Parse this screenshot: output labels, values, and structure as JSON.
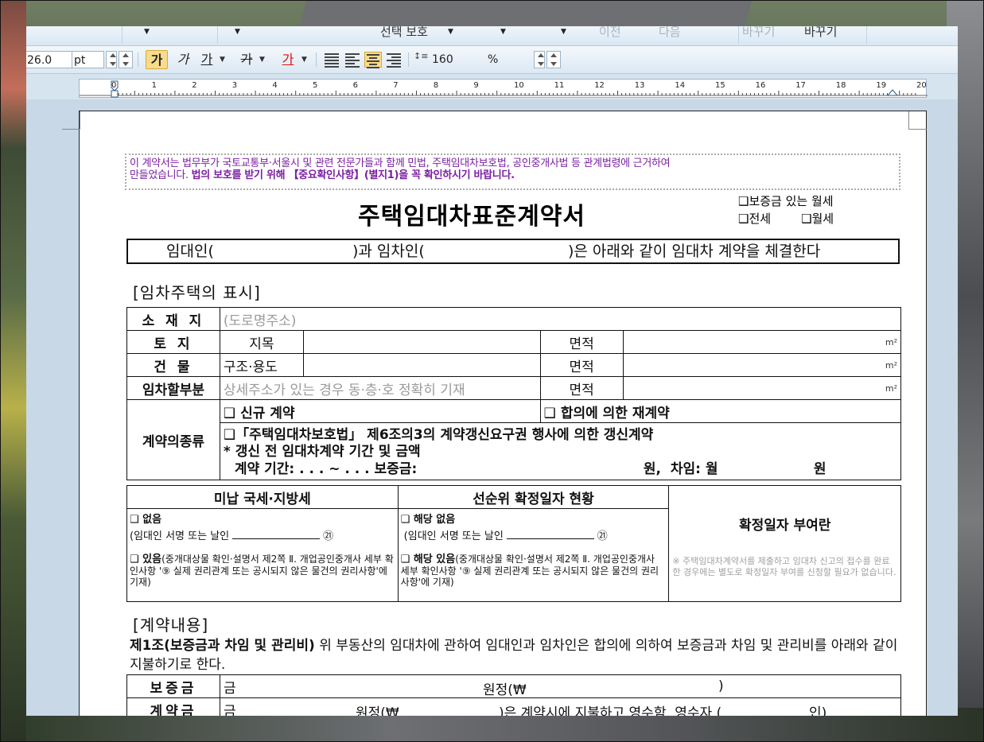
{
  "toolbar_top": {
    "selection_protect": "선택 보호",
    "replace_left": "바꾸기",
    "replace_right": "바꾸기",
    "faint_a": "이전",
    "faint_b": "다음"
  },
  "format_bar": {
    "font_size": "26.0",
    "font_unit": "pt",
    "bold": "가",
    "italic": "가",
    "underline": "가",
    "strike": "가",
    "color": "가",
    "line_spacing": "160",
    "line_spacing_unit": "%"
  },
  "ruler": {
    "ticks": [
      "0",
      "1",
      "2",
      "3",
      "4",
      "5",
      "6",
      "7",
      "8",
      "9",
      "10",
      "11",
      "12",
      "13",
      "14",
      "15",
      "16",
      "17",
      "18",
      "19",
      "20"
    ]
  },
  "document": {
    "notice_line1": "이 계약서는 법무부가 국토교통부·서울시 및 관련 전문가들과 함께 민법, 주택임대차보호법, 공인중개사법 등 관계법령에 근거하여",
    "notice_line2_a": "만들었습니다.",
    "notice_line2_b": "법의 보호를 받기 위해 【중요확인사항】(별지1)을 꼭 확인하시기 바랍니다.",
    "title": "주택임대차표준계약서",
    "type_options": [
      "❑보증금 있는 월세",
      "❑전세",
      "❑월세"
    ],
    "intro_a": "임대인(",
    "intro_b": ")과 임차인(",
    "intro_c": ")은 아래와 같이 임대차 계약을 체결한다",
    "section1": "[임차주택의 표시]",
    "property": {
      "location_label": "소 재 지",
      "location_ph": "(도로명주소)",
      "land_label": "토 지",
      "land_sub": "지목",
      "building_label": "건 물",
      "building_sub": "구조·용도",
      "area_label": "면적",
      "unit": "m²",
      "leased_label": "임차할부분",
      "leased_ph": "상세주소가 있는 경우 동·층·호 정확히 기재",
      "contract_type_label": "계약의종류",
      "new_contract": "❑ 신규 계약",
      "recontract": "❑ 합의에 의한 재계약",
      "renewal": "❑「주택임대차보호법」 제6조의3의 계약갱신요구권 행사에 의한 갱신계약",
      "renewal_note": "* 갱신 전 임대차계약 기간 및 금액",
      "renewal_period": "계약 기간:     .     .     . ~     .     .     .   보증금:",
      "renewal_won": "원,",
      "renewal_rent": "차임: 월",
      "renewal_won2": "원"
    },
    "tax": {
      "header": "미납 국세·지방세",
      "none": "❑ 없음",
      "sign_line": "(임대인 서명 또는 날인",
      "seal": "㉑",
      "exists": "❑ 있음",
      "exists_note": "(중개대상물 확인·설명서 제2쪽 Ⅱ. 개업공인중개사 세부 확인사항 '⑨ 실제 권리관계 또는 공시되지 않은 물건의 권리사항'에 기재)"
    },
    "priority": {
      "header": "선순위 확정일자 현황",
      "none": "❑ 해당 없음",
      "sign_line": "(임대인 서명 또는 날인",
      "seal": "㉑",
      "exists": "❑ 해당 있음",
      "exists_note": "(중개대상물 확인·설명서 제2쪽 Ⅱ. 개업공인중개사 세부 확인사항 '⑨ 실제 권리관계 또는 공시되지 않은 물건의 권리사항'에 기재)"
    },
    "confirm_date": {
      "title": "확정일자 부여란",
      "note": "※ 주택임대차계약서를 제출하고 임대차 신고의 접수를 완료한 경우에는 별도로 확정일자 부여를 신청할 필요가 없습니다."
    },
    "section2": "[계약내용]",
    "art1_head": "제1조(보증금과 차임 및 관리비)",
    "art1_body": " 위 부동산의 임대차에 관하여 임대인과 임차인은 합의에 의하여 보증금과 차임 및 관리비를 아래와 같이 지불하기로 한다.",
    "deposit_label": "보증금",
    "deposit_a": "금",
    "deposit_b": "원정(₩",
    "deposit_c": ")",
    "down_label": "계약금",
    "down_a": "금",
    "down_b": "원정(₩",
    "down_c": ")은 계약시에 지불하고 영수함. 영수자 (",
    "down_d": "인)"
  }
}
